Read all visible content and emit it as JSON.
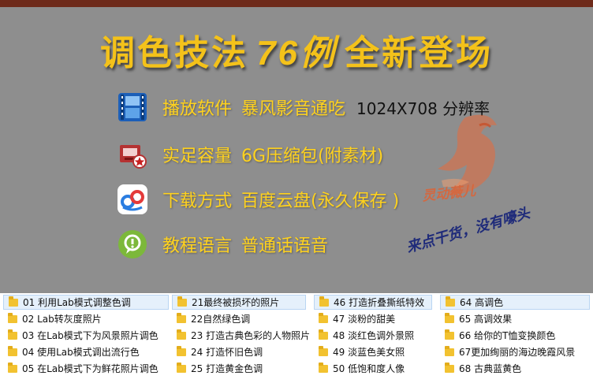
{
  "banner": {
    "title_left": "调色技法",
    "title_num": "76例",
    "title_right": "全新登场",
    "features": [
      {
        "icon": "film-player-icon",
        "label": "播放软件",
        "value": "暴风影音通吃",
        "extra": "1024X708 分辨率"
      },
      {
        "icon": "disk-package-icon",
        "label": "实足容量",
        "value": "6G压缩包(附素材)",
        "extra": ""
      },
      {
        "icon": "baidu-cloud-icon",
        "label": "下载方式",
        "value": "百度云盘(永久保存 )",
        "extra": ""
      },
      {
        "icon": "info-bubble-icon",
        "label": "教程语言",
        "value": "普通话语音",
        "extra": ""
      }
    ],
    "watermark_text": "灵动薇儿",
    "slogan": "来点干货，没有嚎头"
  },
  "files": {
    "columns": [
      [
        "01 利用Lab模式调整色调",
        "02 Lab转灰度照片",
        "03 在Lab模式下为风景照片调色",
        "04 使用Lab模式调出流行色",
        "05 在Lab模式下为鲜花照片调色"
      ],
      [
        "21最终被损坏的照片",
        "22自然绿色调",
        "23 打造古典色彩的人物照片",
        "24 打造怀旧色调",
        "25 打造黄金色调"
      ],
      [
        "46 打造折叠撕纸特效",
        "47 淡粉的甜美",
        "48 淡红色调外景照",
        "49 淡蓝色美女照",
        "50 低饱和度人像"
      ],
      [
        "64 高调色",
        "65 高调效果",
        "66 给你的T恤变换颜色",
        "67更加绚丽的海边晚霞风景",
        "68 古典蓝黄色"
      ]
    ]
  }
}
